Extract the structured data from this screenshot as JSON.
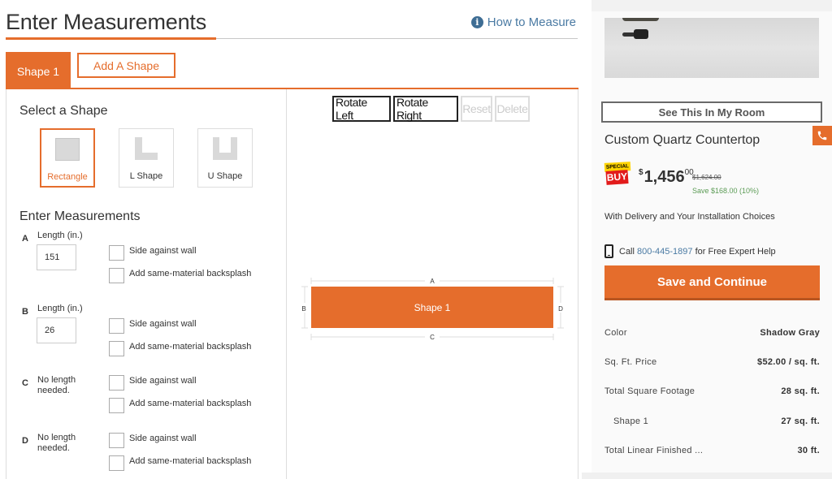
{
  "header": {
    "title": "Enter Measurements",
    "how_to_measure": "How to Measure",
    "info_icon": "i"
  },
  "tabs": {
    "active": "Shape 1",
    "add": "Add A Shape"
  },
  "shape_panel": {
    "select_title": "Select a Shape",
    "shapes": [
      {
        "label": "Rectangle",
        "selected": true
      },
      {
        "label": "L Shape",
        "selected": false
      },
      {
        "label": "U Shape",
        "selected": false
      }
    ],
    "measure_title": "Enter Measurements",
    "sides": [
      {
        "letter": "A",
        "label": "Length (in.)",
        "value": "151",
        "wall": "Side against wall",
        "backsplash": "Add same-material backsplash"
      },
      {
        "letter": "B",
        "label": "Length (in.)",
        "value": "26",
        "wall": "Side against wall",
        "backsplash": "Add same-material backsplash"
      },
      {
        "letter": "C",
        "label": "No length needed.",
        "wall": "Side against wall",
        "backsplash": "Add same-material backsplash"
      },
      {
        "letter": "D",
        "label": "No length needed.",
        "wall": "Side against wall",
        "backsplash": "Add same-material backsplash"
      }
    ]
  },
  "canvas": {
    "buttons": {
      "rotate_left": "Rotate Left",
      "rotate_right": "Rotate Right",
      "reset": "Reset",
      "delete": "Delete"
    },
    "shape_label": "Shape 1",
    "dim_labels": {
      "top": "A",
      "left": "B",
      "bottom": "C",
      "right": "D"
    },
    "shape_color": "#e56d2c",
    "dimensions_in": {
      "A": 151,
      "B": 26
    }
  },
  "sidebar": {
    "see_room": "See This In My Room",
    "product_name": "Custom Quartz Countertop",
    "badge_top": "SPECIAL",
    "badge_bottom": "BUY",
    "price_dollar": "$",
    "price_main": "1,456",
    "price_cents": "00",
    "original_price": "$1,624.00",
    "savings": "Save $168.00 (10%)",
    "delivery": "With Delivery and Your Installation Choices",
    "call_prefix": "Call",
    "phone": "800-445-1897",
    "call_suffix": "for Free Expert Help",
    "save_button": "Save and Continue",
    "specs": [
      {
        "key": "Color",
        "value": "Shadow Gray"
      },
      {
        "key": "Sq. Ft. Price",
        "value": "$52.00 / sq. ft."
      },
      {
        "key": "Total Square Footage",
        "value": "28 sq. ft."
      },
      {
        "key": "Shape 1",
        "value": "27 sq. ft."
      },
      {
        "key": "Total Linear Finished ...",
        "value": "30 ft."
      }
    ]
  },
  "colors": {
    "accent": "#e56d2c",
    "link": "#4a7aa3",
    "savings": "#5b9b55"
  }
}
